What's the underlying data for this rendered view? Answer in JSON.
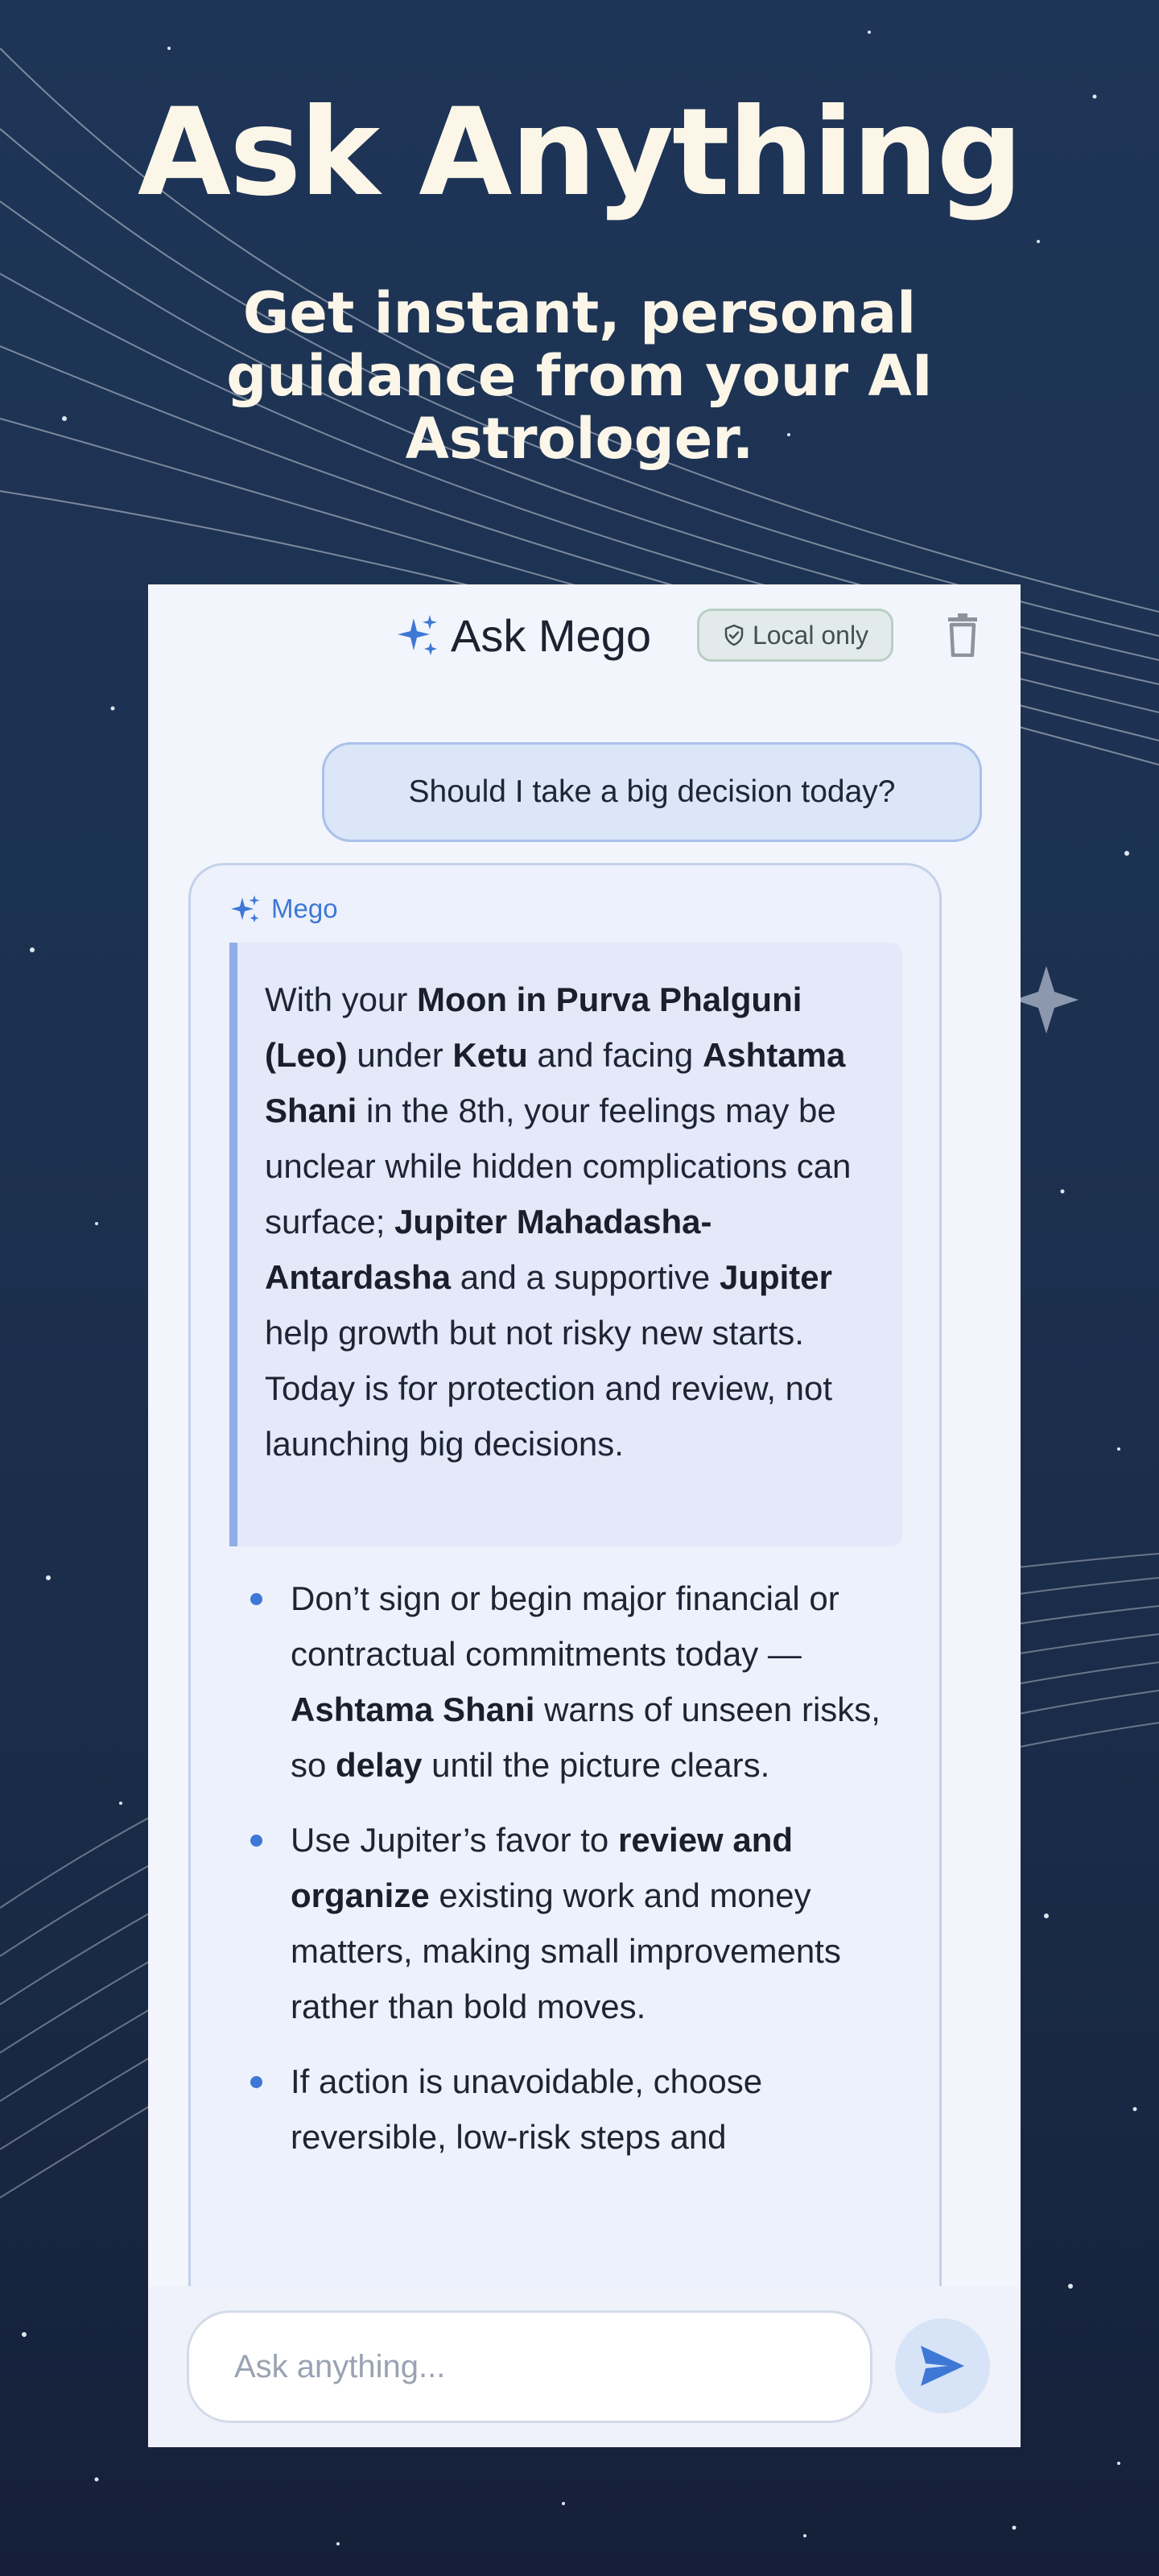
{
  "hero": {
    "title": "Ask Anything",
    "subtitle": "Get instant, personal guidance from your AI Astrologer."
  },
  "chat": {
    "header": {
      "title": "Ask Mego",
      "title_icon": "sparkle-icon",
      "badge_label": "Local only",
      "badge_icon": "shield-check-icon",
      "delete_icon": "trash-icon"
    },
    "user_message": "Should I take a big decision today?",
    "assistant": {
      "name": "Mego",
      "summary": {
        "p1": "With your ",
        "b1": "Moon in Purva Phalguni (Leo)",
        "p2": " under ",
        "b2": "Ketu",
        "p3": " and facing ",
        "b3": "Ashtama Shani",
        "p4": " in the 8th, your feelings may be unclear while hidden complications can surface; ",
        "b4": "Jupiter Mahadasha-Antardasha",
        "p5": " and a supportive ",
        "b5": "Jupiter",
        "p6": " help growth but not risky new starts. Today is for protection and review, not launching big decisions."
      },
      "bullets": [
        {
          "t1": "Don’t sign or begin major financial or contractual commitments today — ",
          "b1": "Ashtama Shani",
          "t2": " warns of unseen risks, so ",
          "b2": "delay",
          "t3": " until the picture clears."
        },
        {
          "t1": "Use Jupiter’s favor to ",
          "b1": "review and organize",
          "t2": " existing work and money matters, making small improvements rather than bold moves."
        },
        {
          "t1": "If action is unavoidable, choose reversible, low-risk steps and"
        }
      ]
    },
    "composer": {
      "placeholder": "Ask anything...",
      "send_icon": "send-icon"
    }
  },
  "colors": {
    "background_top": "#1f3557",
    "background_bottom": "#151f38",
    "accent": "#3e78d6",
    "title_text": "#fbf6e8"
  }
}
